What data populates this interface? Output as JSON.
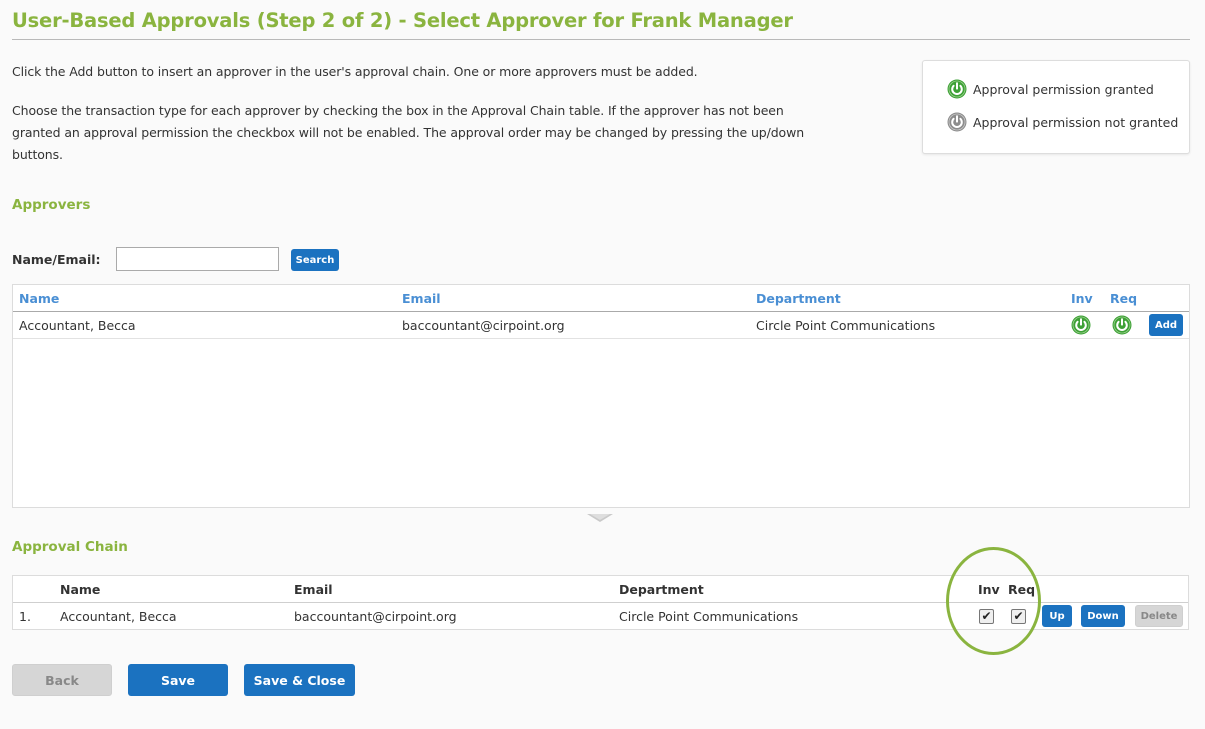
{
  "page": {
    "title": "User-Based Approvals (Step 2 of 2) - Select Approver for Frank Manager",
    "intro_line1": "Click the Add button to insert an approver in the user's approval chain. One or more approvers must be added.",
    "intro_line2": "Choose the transaction type for each approver by checking the box in the Approval Chain table. If the approver has not been granted an approval permission the checkbox will not be enabled. The approval order may be changed by pressing the up/down buttons."
  },
  "legend": {
    "granted_label": "Approval permission granted",
    "granted_icon": "power-granted-icon",
    "not_granted_label": "Approval permission not granted",
    "not_granted_icon": "power-not-granted-icon",
    "granted_color": "#3ea136",
    "not_granted_color": "#8c8c8c"
  },
  "approvers": {
    "heading": "Approvers",
    "search_label": "Name/Email:",
    "search_value": "",
    "search_button": "Search",
    "columns": {
      "name": "Name",
      "email": "Email",
      "department": "Department",
      "inv": "Inv",
      "req": "Req"
    },
    "rows": [
      {
        "name": "Accountant, Becca",
        "email": "baccountant@cirpoint.org",
        "department": "Circle Point Communications",
        "inv_granted": true,
        "req_granted": true,
        "action": "Add"
      }
    ]
  },
  "approval_chain": {
    "heading": "Approval Chain",
    "columns": {
      "name": "Name",
      "email": "Email",
      "department": "Department",
      "inv": "Inv",
      "req": "Req"
    },
    "rows": [
      {
        "index": "1.",
        "name": "Accountant, Becca",
        "email": "baccountant@cirpoint.org",
        "department": "Circle Point Communications",
        "inv_checked": true,
        "req_checked": true,
        "up": "Up",
        "down": "Down",
        "delete": "Delete"
      }
    ]
  },
  "footer": {
    "back": "Back",
    "save": "Save",
    "save_close": "Save & Close"
  },
  "colors": {
    "accent_green": "#8ab43f",
    "primary_blue": "#1b72c0",
    "header_blue": "#4a8fd4"
  }
}
